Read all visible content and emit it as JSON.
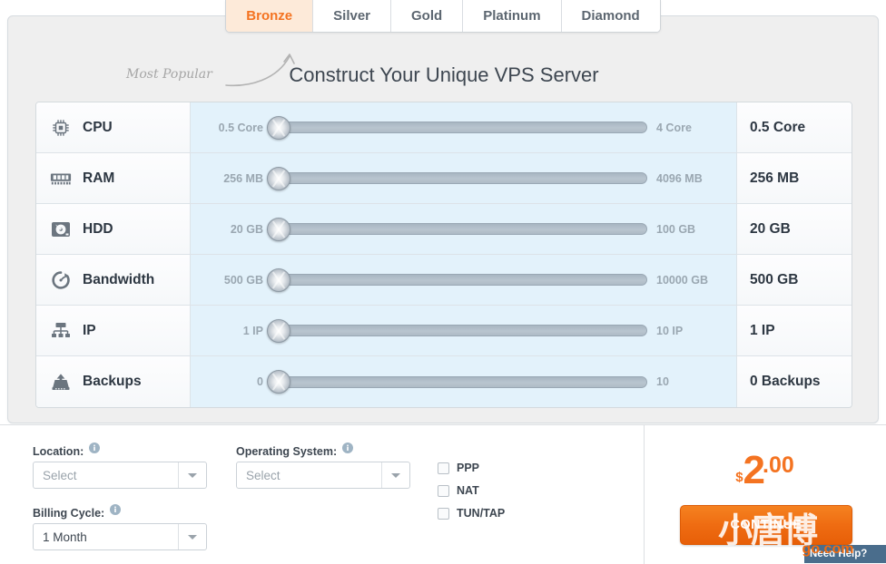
{
  "tabs": [
    {
      "label": "Bronze",
      "active": true
    },
    {
      "label": "Silver",
      "active": false
    },
    {
      "label": "Gold",
      "active": false
    },
    {
      "label": "Platinum",
      "active": false
    },
    {
      "label": "Diamond",
      "active": false
    }
  ],
  "annotation": {
    "most_popular": "Most Popular",
    "arrow_icon": "curved-arrow-up-right-icon"
  },
  "title": "Construct Your Unique VPS Server",
  "specs": [
    {
      "icon": "cpu-chip-icon",
      "name": "CPU",
      "min_label": "0.5 Core",
      "max_label": "4 Core",
      "value": "0.5 Core",
      "handle_percent": 0
    },
    {
      "icon": "ram-module-icon",
      "name": "RAM",
      "min_label": "256 MB",
      "max_label": "4096 MB",
      "value": "256 MB",
      "handle_percent": 0
    },
    {
      "icon": "hard-disk-icon",
      "name": "HDD",
      "min_label": "20 GB",
      "max_label": "100 GB",
      "value": "20 GB",
      "handle_percent": 0
    },
    {
      "icon": "speedometer-icon",
      "name": "Bandwidth",
      "min_label": "500 GB",
      "max_label": "10000 GB",
      "value": "500 GB",
      "handle_percent": 0
    },
    {
      "icon": "network-topology-icon",
      "name": "IP",
      "min_label": "1 IP",
      "max_label": "10 IP",
      "value": "1 IP",
      "handle_percent": 0
    },
    {
      "icon": "backup-archive-icon",
      "name": "Backups",
      "min_label": "0",
      "max_label": "10",
      "value": "0 Backups",
      "handle_percent": 0
    }
  ],
  "form": {
    "location": {
      "label": "Location:",
      "value": "Select",
      "placeholder": "Select",
      "filled": false,
      "info_icon": "info-icon"
    },
    "operating_system": {
      "label": "Operating System:",
      "value": "Select",
      "placeholder": "Select",
      "filled": false,
      "info_icon": "info-icon"
    },
    "billing_cycle": {
      "label": "Billing Cycle:",
      "value": "1 Month",
      "filled": true,
      "info_icon": "info-icon"
    },
    "checkboxes": [
      {
        "label": "PPP",
        "checked": false
      },
      {
        "label": "NAT",
        "checked": false
      },
      {
        "label": "TUN/TAP",
        "checked": false
      }
    ]
  },
  "price": {
    "currency": "$",
    "integer": "2",
    "decimal": ".00"
  },
  "continue_button": "CONTINUE",
  "watermark": {
    "text_cn": "小唐博",
    "url": "go.com"
  },
  "need_help": "Need Help?",
  "colors": {
    "accent_orange": "#f47321",
    "slider_row_bg": "#e3f2fb",
    "panel_bg": "#efefef",
    "active_tab_bg": "#fdead9"
  }
}
